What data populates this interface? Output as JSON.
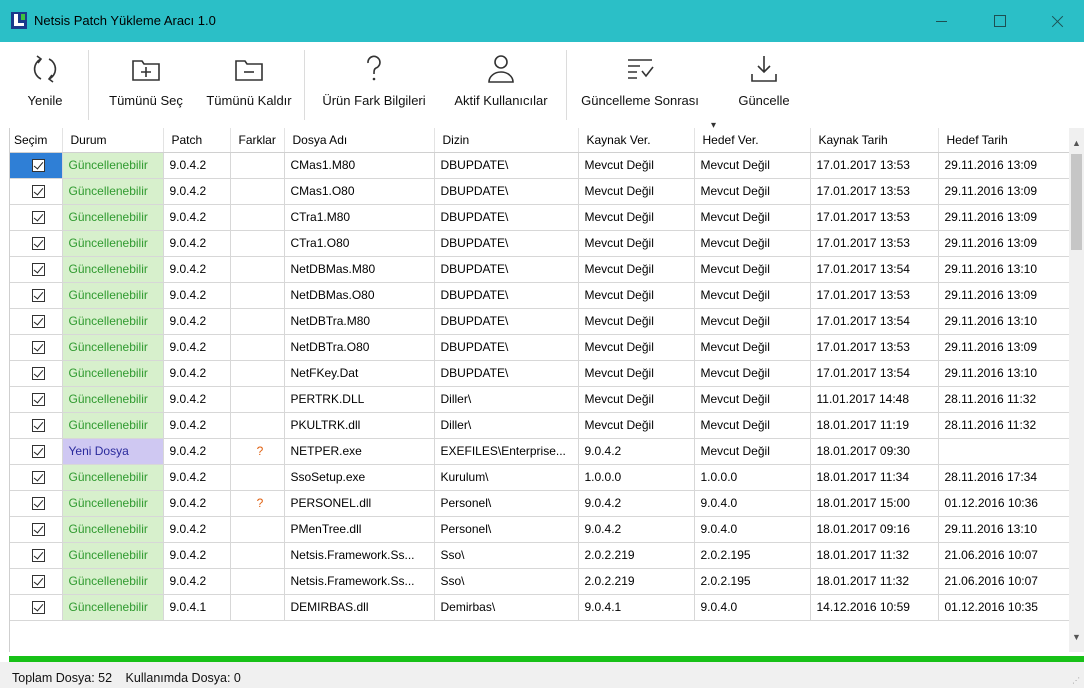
{
  "window": {
    "title": "Netsis Patch Yükleme Aracı 1.0"
  },
  "toolbar": {
    "refresh_label": "Yenile",
    "select_all_label": "Tümünü Seç",
    "deselect_all_label": "Tümünü Kaldır",
    "product_diff_label": "Ürün Fark Bilgileri",
    "active_users_label": "Aktif Kullanıcılar",
    "after_update_label": "Güncelleme Sonrası",
    "update_label": "Güncelle",
    "dropdown_glyph": "▾"
  },
  "grid": {
    "columns": [
      "Seçim",
      "Durum",
      "Patch",
      "Farklar",
      "Dosya Adı",
      "Dizin",
      "Kaynak Ver.",
      "Hedef Ver.",
      "Kaynak Tarih",
      "Hedef Tarih"
    ],
    "rows": [
      {
        "checked": true,
        "status": "Güncellenebilir",
        "status_type": "upd",
        "patch": "9.0.4.2",
        "diff": "",
        "file": "CMas1.M80",
        "dir": "DBUPDATE\\",
        "src_ver": "Mevcut Değil",
        "dst_ver": "Mevcut Değil",
        "src_date": "17.01.2017 13:53",
        "dst_date": "29.11.2016 13:09"
      },
      {
        "checked": true,
        "status": "Güncellenebilir",
        "status_type": "upd",
        "patch": "9.0.4.2",
        "diff": "",
        "file": "CMas1.O80",
        "dir": "DBUPDATE\\",
        "src_ver": "Mevcut Değil",
        "dst_ver": "Mevcut Değil",
        "src_date": "17.01.2017 13:53",
        "dst_date": "29.11.2016 13:09"
      },
      {
        "checked": true,
        "status": "Güncellenebilir",
        "status_type": "upd",
        "patch": "9.0.4.2",
        "diff": "",
        "file": "CTra1.M80",
        "dir": "DBUPDATE\\",
        "src_ver": "Mevcut Değil",
        "dst_ver": "Mevcut Değil",
        "src_date": "17.01.2017 13:53",
        "dst_date": "29.11.2016 13:09"
      },
      {
        "checked": true,
        "status": "Güncellenebilir",
        "status_type": "upd",
        "patch": "9.0.4.2",
        "diff": "",
        "file": "CTra1.O80",
        "dir": "DBUPDATE\\",
        "src_ver": "Mevcut Değil",
        "dst_ver": "Mevcut Değil",
        "src_date": "17.01.2017 13:53",
        "dst_date": "29.11.2016 13:09"
      },
      {
        "checked": true,
        "status": "Güncellenebilir",
        "status_type": "upd",
        "patch": "9.0.4.2",
        "diff": "",
        "file": "NetDBMas.M80",
        "dir": "DBUPDATE\\",
        "src_ver": "Mevcut Değil",
        "dst_ver": "Mevcut Değil",
        "src_date": "17.01.2017 13:54",
        "dst_date": "29.11.2016 13:10"
      },
      {
        "checked": true,
        "status": "Güncellenebilir",
        "status_type": "upd",
        "patch": "9.0.4.2",
        "diff": "",
        "file": "NetDBMas.O80",
        "dir": "DBUPDATE\\",
        "src_ver": "Mevcut Değil",
        "dst_ver": "Mevcut Değil",
        "src_date": "17.01.2017 13:53",
        "dst_date": "29.11.2016 13:09"
      },
      {
        "checked": true,
        "status": "Güncellenebilir",
        "status_type": "upd",
        "patch": "9.0.4.2",
        "diff": "",
        "file": "NetDBTra.M80",
        "dir": "DBUPDATE\\",
        "src_ver": "Mevcut Değil",
        "dst_ver": "Mevcut Değil",
        "src_date": "17.01.2017 13:54",
        "dst_date": "29.11.2016 13:10"
      },
      {
        "checked": true,
        "status": "Güncellenebilir",
        "status_type": "upd",
        "patch": "9.0.4.2",
        "diff": "",
        "file": "NetDBTra.O80",
        "dir": "DBUPDATE\\",
        "src_ver": "Mevcut Değil",
        "dst_ver": "Mevcut Değil",
        "src_date": "17.01.2017 13:53",
        "dst_date": "29.11.2016 13:09"
      },
      {
        "checked": true,
        "status": "Güncellenebilir",
        "status_type": "upd",
        "patch": "9.0.4.2",
        "diff": "",
        "file": "NetFKey.Dat",
        "dir": "DBUPDATE\\",
        "src_ver": "Mevcut Değil",
        "dst_ver": "Mevcut Değil",
        "src_date": "17.01.2017 13:54",
        "dst_date": "29.11.2016 13:10"
      },
      {
        "checked": true,
        "status": "Güncellenebilir",
        "status_type": "upd",
        "patch": "9.0.4.2",
        "diff": "",
        "file": "PERTRK.DLL",
        "dir": "Diller\\",
        "src_ver": "Mevcut Değil",
        "dst_ver": "Mevcut Değil",
        "src_date": "11.01.2017 14:48",
        "dst_date": "28.11.2016 11:32"
      },
      {
        "checked": true,
        "status": "Güncellenebilir",
        "status_type": "upd",
        "patch": "9.0.4.2",
        "diff": "",
        "file": "PKULTRK.dll",
        "dir": "Diller\\",
        "src_ver": "Mevcut Değil",
        "dst_ver": "Mevcut Değil",
        "src_date": "18.01.2017 11:19",
        "dst_date": "28.11.2016 11:32"
      },
      {
        "checked": true,
        "status": "Yeni Dosya",
        "status_type": "new",
        "patch": "9.0.4.2",
        "diff": "?",
        "file": "NETPER.exe",
        "dir": "EXEFILES\\Enterprise...",
        "src_ver": "9.0.4.2",
        "dst_ver": "Mevcut Değil",
        "src_date": "18.01.2017 09:30",
        "dst_date": ""
      },
      {
        "checked": true,
        "status": "Güncellenebilir",
        "status_type": "upd",
        "patch": "9.0.4.2",
        "diff": "",
        "file": "SsoSetup.exe",
        "dir": "Kurulum\\",
        "src_ver": "1.0.0.0",
        "dst_ver": "1.0.0.0",
        "src_date": "18.01.2017 11:34",
        "dst_date": "28.11.2016 17:34"
      },
      {
        "checked": true,
        "status": "Güncellenebilir",
        "status_type": "upd",
        "patch": "9.0.4.2",
        "diff": "?",
        "file": "PERSONEL.dll",
        "dir": "Personel\\",
        "src_ver": "9.0.4.2",
        "dst_ver": "9.0.4.0",
        "src_date": "18.01.2017 15:00",
        "dst_date": "01.12.2016 10:36"
      },
      {
        "checked": true,
        "status": "Güncellenebilir",
        "status_type": "upd",
        "patch": "9.0.4.2",
        "diff": "",
        "file": "PMenTree.dll",
        "dir": "Personel\\",
        "src_ver": "9.0.4.2",
        "dst_ver": "9.0.4.0",
        "src_date": "18.01.2017 09:16",
        "dst_date": "29.11.2016 13:10"
      },
      {
        "checked": true,
        "status": "Güncellenebilir",
        "status_type": "upd",
        "patch": "9.0.4.2",
        "diff": "",
        "file": "Netsis.Framework.Ss...",
        "dir": "Sso\\",
        "src_ver": "2.0.2.219",
        "dst_ver": "2.0.2.195",
        "src_date": "18.01.2017 11:32",
        "dst_date": "21.06.2016 10:07"
      },
      {
        "checked": true,
        "status": "Güncellenebilir",
        "status_type": "upd",
        "patch": "9.0.4.2",
        "diff": "",
        "file": "Netsis.Framework.Ss...",
        "dir": "Sso\\",
        "src_ver": "2.0.2.219",
        "dst_ver": "2.0.2.195",
        "src_date": "18.01.2017 11:32",
        "dst_date": "21.06.2016 10:07"
      },
      {
        "checked": true,
        "status": "Güncellenebilir",
        "status_type": "upd",
        "patch": "9.0.4.1",
        "diff": "",
        "file": "DEMIRBAS.dll",
        "dir": "Demirbas\\",
        "src_ver": "9.0.4.1",
        "dst_ver": "9.0.4.0",
        "src_date": "14.12.2016 10:59",
        "dst_date": "01.12.2016 10:35"
      }
    ]
  },
  "status": {
    "total_files": "Toplam Dosya: 52",
    "files_in_use": "Kullanımda Dosya: 0"
  },
  "colors": {
    "titlebar": "#2bbfc7",
    "status_updatable_bg": "#d7f0cc",
    "status_new_bg": "#cfc8f2",
    "progress_green": "#17c117",
    "selection_blue": "#2f7fd6"
  },
  "progress": {
    "fraction": 1.0
  }
}
